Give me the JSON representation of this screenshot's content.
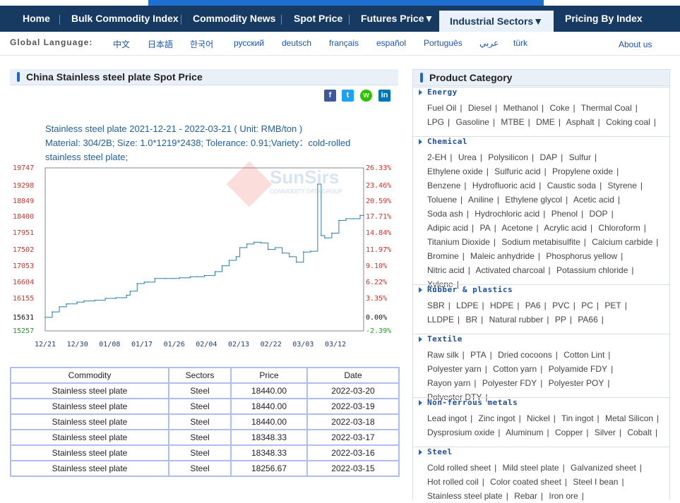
{
  "nav": {
    "items": [
      "Home",
      "Bulk Commodity Index",
      "Commodity News",
      "Spot Price",
      "Futures Price▼",
      "Industrial Sectors▼",
      "Pricing By Index"
    ]
  },
  "lang": {
    "label": "Global  Language:",
    "items": [
      "中文",
      "日本語",
      "한국어",
      "русский",
      "deutsch",
      "français",
      "español",
      "Português",
      "عربي",
      "türk"
    ],
    "about": "About us"
  },
  "main": {
    "title": "China Stainless steel plate Spot Price",
    "share_icons": [
      "facebook-icon",
      "twitter-icon",
      "wechat-icon",
      "linkedin-icon"
    ],
    "info_line1": "Stainless steel plate 2021-12-21 - 2022-03-21    ( Unit: RMB/ton )",
    "info_line2": "Material: 304/2B; Size: 1.0*1219*2438; Tolerance: 0.91;Variety：cold-rolled stainless steel plate;",
    "watermark": "SunSirs",
    "watermark_sub": "COMMODITY DATA GROUP"
  },
  "chart_data": {
    "type": "line",
    "left_ticks": [
      "19747",
      "19298",
      "18849",
      "18400",
      "17951",
      "17502",
      "17053",
      "16604",
      "16155",
      "15631",
      "15257"
    ],
    "right_ticks": [
      "26.33%",
      "23.46%",
      "20.59%",
      "17.71%",
      "14.84%",
      "11.97%",
      "9.10%",
      "6.22%",
      "3.35%",
      "0.00%",
      "-2.39%"
    ],
    "x_ticks": [
      "12/21",
      "12/30",
      "01/08",
      "01/17",
      "01/26",
      "02/04",
      "02/13",
      "02/22",
      "03/03",
      "03/12"
    ],
    "ylim": [
      15257,
      19747
    ],
    "x": [
      "12/21",
      "12/23",
      "12/25",
      "12/27",
      "12/30",
      "01/01",
      "01/04",
      "01/07",
      "01/10",
      "01/13",
      "01/14",
      "01/16",
      "01/18",
      "01/19",
      "01/21",
      "01/24",
      "01/26",
      "01/28",
      "01/31",
      "02/02",
      "02/04",
      "02/07",
      "02/09",
      "02/11",
      "02/13",
      "02/14",
      "02/16",
      "02/18",
      "02/20",
      "02/22",
      "02/24",
      "02/26",
      "02/28",
      "03/02",
      "03/04",
      "03/06",
      "03/08",
      "03/09",
      "03/10",
      "03/12",
      "03/14",
      "03/16",
      "03/18",
      "03/20",
      "03/21"
    ],
    "values": [
      15631,
      15780,
      15920,
      16000,
      16050,
      16080,
      16100,
      16150,
      16170,
      16240,
      16350,
      16560,
      16600,
      16600,
      16700,
      16700,
      16700,
      16720,
      16750,
      16750,
      16780,
      16890,
      17050,
      17200,
      17300,
      17550,
      17650,
      17700,
      17680,
      17500,
      17550,
      17400,
      17300,
      17150,
      17430,
      17450,
      19300,
      17880,
      17820,
      17950,
      18300,
      18348,
      18348,
      18440,
      18440
    ],
    "line_color": "#2a7fb0",
    "grid": false
  },
  "table": {
    "headers": [
      "Commodity",
      "Sectors",
      "Price",
      "Date"
    ],
    "rows": [
      [
        "Stainless steel plate",
        "Steel",
        "18440.00",
        "2022-03-20"
      ],
      [
        "Stainless steel plate",
        "Steel",
        "18440.00",
        "2022-03-19"
      ],
      [
        "Stainless steel plate",
        "Steel",
        "18440.00",
        "2022-03-18"
      ],
      [
        "Stainless steel plate",
        "Steel",
        "18348.33",
        "2022-03-17"
      ],
      [
        "Stainless steel plate",
        "Steel",
        "18348.33",
        "2022-03-16"
      ],
      [
        "Stainless steel plate",
        "Steel",
        "18256.67",
        "2022-03-15"
      ]
    ]
  },
  "category": {
    "title": "Product Category",
    "sections": [
      {
        "title": "Energy",
        "items": [
          "Fuel Oil",
          "Diesel",
          "Methanol",
          "Coke",
          "Thermal Coal",
          "LPG",
          "Gasoline",
          "MTBE",
          "DME",
          "Asphalt",
          "Coking coal"
        ]
      },
      {
        "title": "Chemical",
        "items": [
          "2-EH",
          "Urea",
          "Polysilicon",
          "DAP",
          "Sulfur",
          "Ethylene oxide",
          "Sulfuric acid",
          "Propylene oxide",
          "Benzene",
          "Hydrofluoric acid",
          "Caustic soda",
          "Styrene",
          "Toluene",
          "Aniline",
          "Ethylene glycol",
          "Acetic acid",
          "Soda ash",
          "Hydrochloric acid",
          "Phenol",
          "DOP",
          "Adipic acid",
          "PA",
          "Acetone",
          "Acrylic acid",
          "Chloroform",
          "Titanium Dioxide",
          "Sodium metabisulfite",
          "Calcium carbide",
          "Bromine",
          "Maleic anhydride",
          "Phosphorus yellow",
          "Nitric acid",
          "Activated charcoal",
          "Potassium chloride",
          "Xylene"
        ]
      },
      {
        "title": "Rubber & plastics",
        "items": [
          "SBR",
          "LDPE",
          "HDPE",
          "PA6",
          "PVC",
          "PC",
          "PET",
          "LLDPE",
          "BR",
          "Natural rubber",
          "PP",
          "PA66"
        ]
      },
      {
        "title": "Textile",
        "items": [
          "Raw silk",
          "PTA",
          "Dried cocoons",
          "Cotton Lint",
          "Polyester yarn",
          "Cotton yarn",
          "Polyamide FDY",
          "Rayon yarn",
          "Polyester FDY",
          "Polyester POY",
          "Polyester DTY"
        ]
      },
      {
        "title": "Non-ferrous metals",
        "items": [
          "Lead ingot",
          "Zinc ingot",
          "Nickel",
          "Tin ingot",
          "Metal Silicon",
          "Dysprosium oxide",
          "Aluminum",
          "Copper",
          "Silver",
          "Cobalt"
        ]
      },
      {
        "title": "Steel",
        "items": [
          "Cold rolled sheet",
          "Mild steel plate",
          "Galvanized sheet",
          "Hot rolled coil",
          "Color coated sheet",
          "Steel I bean",
          "Stainless steel plate",
          "Rebar",
          "Iron ore"
        ]
      }
    ]
  }
}
